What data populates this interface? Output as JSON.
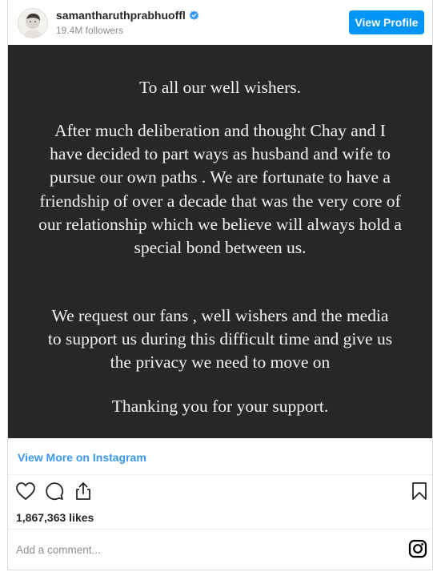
{
  "header": {
    "username": "samantharuthprabhuoffl",
    "followers": "19.4M followers",
    "view_profile_label": "View Profile"
  },
  "post": {
    "paragraphs": [
      "To all our well wishers.",
      "After much deliberation and thought Chay and I have decided to part ways as husband and wife to pursue our own paths . We are fortunate to have a friendship of over a decade that was the very core of our relationship which we believe will always hold a special bond between us.",
      "We request our fans , well wishers and the media to support us during this difficult time and give us the privacy we need to move on",
      "Thanking you for your support."
    ],
    "background_color": "#272727",
    "text_color": "#f2f2f2"
  },
  "view_more_label": "View More on Instagram",
  "likes": "1,867,363 likes",
  "comment_placeholder": "Add a comment...",
  "icons": [
    "verified-badge-icon",
    "heart-icon",
    "comment-icon",
    "share-icon",
    "bookmark-icon",
    "instagram-icon"
  ],
  "colors": {
    "accent": "#0095f6",
    "link": "#3897f0",
    "muted": "#8e8e8e"
  }
}
